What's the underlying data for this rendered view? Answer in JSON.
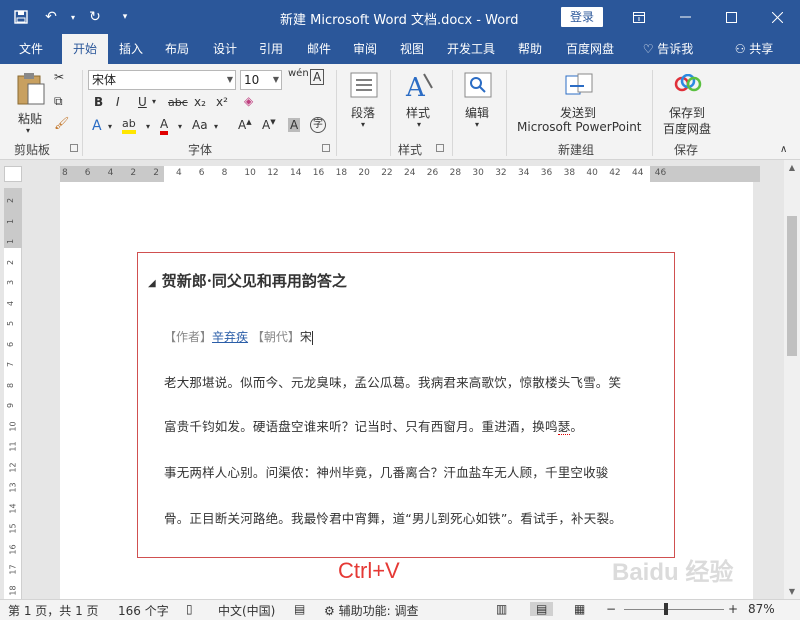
{
  "window": {
    "title": "新建 Microsoft Word 文档.docx - Word",
    "login_label": "登录"
  },
  "tabs": [
    {
      "label": "文件"
    },
    {
      "label": "开始"
    },
    {
      "label": "插入"
    },
    {
      "label": "布局"
    },
    {
      "label": "设计"
    },
    {
      "label": "引用"
    },
    {
      "label": "邮件"
    },
    {
      "label": "审阅"
    },
    {
      "label": "视图"
    },
    {
      "label": "开发工具"
    },
    {
      "label": "帮助"
    },
    {
      "label": "百度网盘"
    }
  ],
  "tell_me": "告诉我",
  "share": "共享",
  "ribbon": {
    "paste_label": "粘贴",
    "clipboard_label": "剪贴板",
    "font_name": "宋体",
    "font_size": "10",
    "font_group_label": "字体",
    "paragraph_label": "段落",
    "styles_label": "样式",
    "styles_group_label": "样式",
    "edit_label": "编辑",
    "send_to_label": "发送到",
    "send_to_target": "Microsoft PowerPoint",
    "new_group_label": "新建组",
    "save_to_label": "保存到",
    "save_to_target": "百度网盘",
    "save_group_label": "保存"
  },
  "ruler": {
    "h_numbers": [
      "8",
      "6",
      "4",
      "2",
      "2",
      "4",
      "6",
      "8",
      "10",
      "12",
      "14",
      "16",
      "18",
      "20",
      "22",
      "24",
      "26",
      "28",
      "30",
      "32",
      "34",
      "36",
      "38",
      "40",
      "42",
      "44",
      "46"
    ],
    "v_numbers": [
      "2",
      "1",
      "1",
      "2",
      "3",
      "4",
      "5",
      "6",
      "7",
      "8",
      "9",
      "10",
      "11",
      "12",
      "13",
      "14",
      "15",
      "16",
      "17",
      "18"
    ]
  },
  "document": {
    "heading": "贺新郎·同父见和再用韵答之",
    "author_prefix": "【作者】",
    "author": "辛弃疾",
    "dynasty_prefix": " 【朝代】",
    "dynasty": "宋",
    "lines": [
      "老大那堪说。似而今、元龙臭味，孟公瓜葛。我病君来高歌饮，惊散楼头飞雪。笑",
      "富贵千钧如发。硬语盘空谁来听？记当时、只有西窗月。重进酒，换鸣",
      "事无两样人心别。问渠侬：神州毕竟，几番离合？汗血盐车无人顾，千里空收骏",
      "骨。正目断关河路绝。我最怜君中宵舞，道“男儿到死心如铁”。看试手，补天裂。"
    ],
    "line2_tail": "瑟",
    "line2_end": "。"
  },
  "overlay": {
    "hotkey": "Ctrl+V",
    "watermark": "Baidu 经验"
  },
  "status": {
    "page": "第 1 页，共 1 页",
    "words": "166 个字",
    "language": "中文(中国)",
    "accessibility": "辅助功能: 调查",
    "zoom": "87%"
  }
}
